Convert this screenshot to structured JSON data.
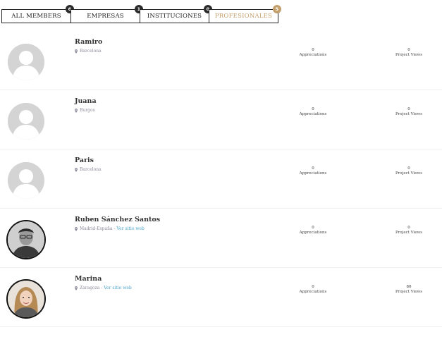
{
  "tabs": [
    {
      "label": "All Members",
      "count": "6",
      "active": false
    },
    {
      "label": "Empresas",
      "count": "1",
      "active": false
    },
    {
      "label": "Instituciones",
      "count": "0",
      "active": false
    },
    {
      "label": "Profesionales",
      "count": "5",
      "active": true
    }
  ],
  "members": [
    {
      "name": "Ramiro",
      "location": "Barcelona",
      "website": "",
      "appreciations": "0",
      "appreciations_label": "Appreciations",
      "views": "0",
      "views_label": "Project Views",
      "avatar": "placeholder"
    },
    {
      "name": "Juana",
      "location": "Burgos",
      "website": "",
      "appreciations": "0",
      "appreciations_label": "Appreciations",
      "views": "0",
      "views_label": "Project Views",
      "avatar": "placeholder"
    },
    {
      "name": "Paris",
      "location": "Barcelona",
      "website": "",
      "appreciations": "0",
      "appreciations_label": "Appreciations",
      "views": "0",
      "views_label": "Project Views",
      "avatar": "placeholder"
    },
    {
      "name": "Ruben Sánchez Santos",
      "location": "Madrid-España",
      "website": "Ver sitio web",
      "appreciations": "0",
      "appreciations_label": "Appreciations",
      "views": "0",
      "views_label": "Project Views",
      "avatar": "photo-man"
    },
    {
      "name": "Marina",
      "location": "Zaragoza",
      "website": "Ver sitio web",
      "appreciations": "0",
      "appreciations_label": "Appreciations",
      "views": "80",
      "views_label": "Project Views",
      "avatar": "photo-woman"
    }
  ],
  "separator": " - ",
  "colors": {
    "accent": "#c3a06b",
    "link": "#4aa3c9",
    "badge": "#2b2b2b"
  }
}
